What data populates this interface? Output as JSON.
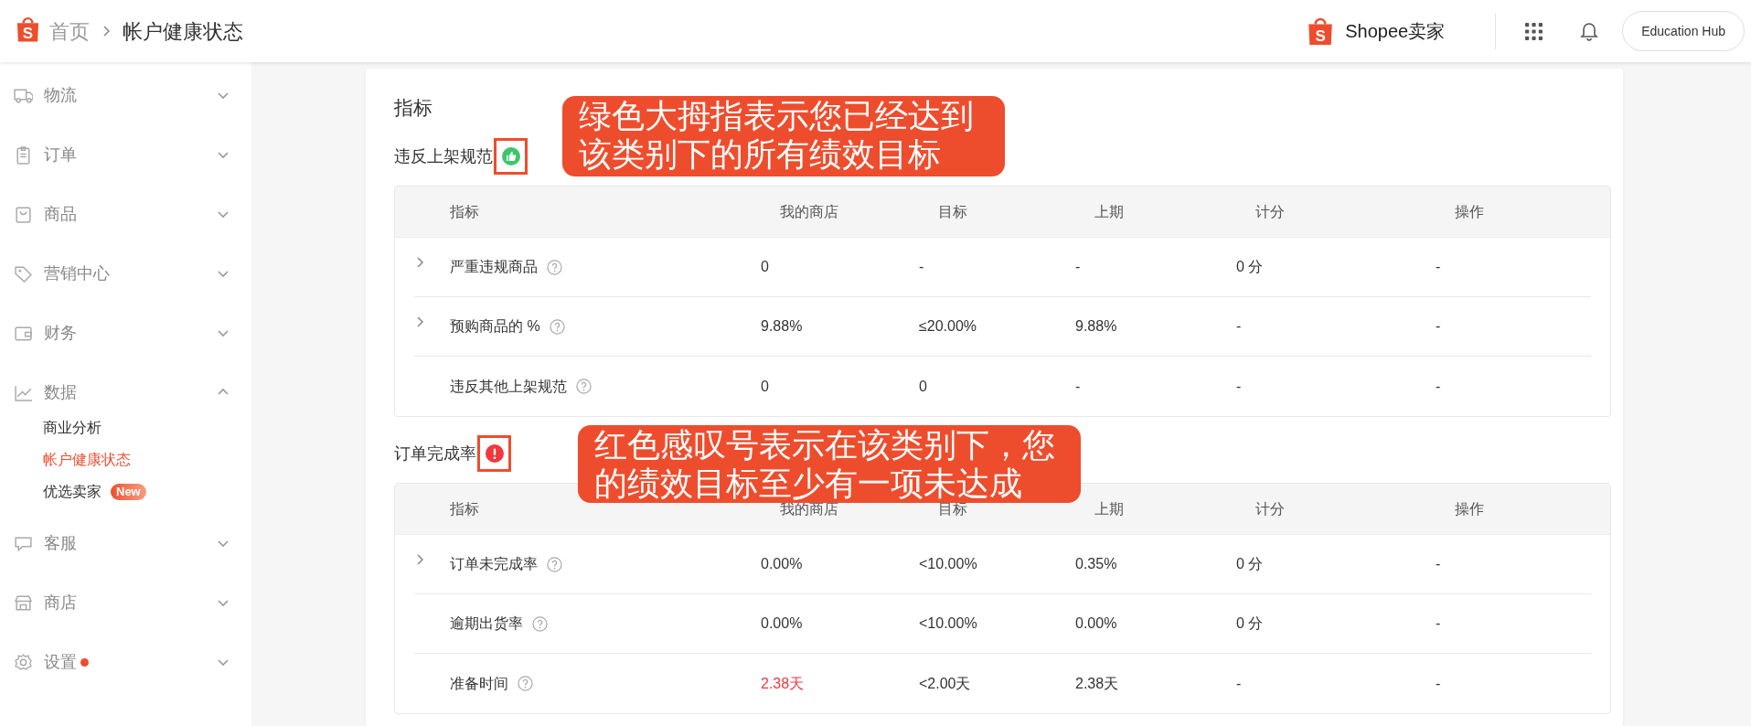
{
  "header": {
    "logo_letter": "S",
    "breadcrumb": [
      {
        "label": "首页"
      },
      {
        "label": "帐户健康状态"
      }
    ],
    "brand": {
      "logo_letter": "S",
      "name": "Shopee卖家"
    },
    "help_button": "Education Hub"
  },
  "sidebar": {
    "items": [
      {
        "label": "物流",
        "expanded": false,
        "notification": false
      },
      {
        "label": "订单",
        "expanded": false,
        "notification": false
      },
      {
        "label": "商品",
        "expanded": false,
        "notification": false
      },
      {
        "label": "营销中心",
        "expanded": false,
        "notification": false
      },
      {
        "label": "财务",
        "expanded": false,
        "notification": false
      },
      {
        "label": "数据",
        "expanded": true,
        "notification": false,
        "children": [
          {
            "label": "商业分析",
            "selected": false
          },
          {
            "label": "帐户健康状态",
            "selected": true
          },
          {
            "label": "优选卖家",
            "selected": false,
            "badge": "New"
          }
        ]
      },
      {
        "label": "客服",
        "expanded": false,
        "notification": false
      },
      {
        "label": "商店",
        "expanded": false,
        "notification": false
      },
      {
        "label": "设置",
        "expanded": false,
        "notification": true
      }
    ]
  },
  "main": {
    "title": "指标",
    "sections": [
      {
        "title": "违反上架规范",
        "goals_met": true,
        "columns": [
          "指标",
          "我的商店",
          "目标",
          "上期",
          "计分",
          "操作"
        ],
        "rows": [
          {
            "expandable": true,
            "off_target": false,
            "cells": [
              "严重违规商品",
              "0",
              "-",
              "-",
              "0 分",
              "-"
            ]
          },
          {
            "expandable": true,
            "off_target": false,
            "cells": [
              "预购商品的 %",
              "9.88%",
              "≤20.00%",
              "9.88%",
              "-",
              "-"
            ]
          },
          {
            "expandable": false,
            "off_target": false,
            "cells": [
              "违反其他上架规范",
              "0",
              "0",
              "-",
              "-",
              "-"
            ]
          }
        ]
      },
      {
        "title": "订单完成率",
        "goals_met": false,
        "columns": [
          "指标",
          "我的商店",
          "目标",
          "上期",
          "计分",
          "操作"
        ],
        "rows": [
          {
            "expandable": true,
            "off_target": false,
            "cells": [
              "订单未完成率",
              "0.00%",
              "<10.00%",
              "0.35%",
              "0 分",
              "-"
            ]
          },
          {
            "expandable": false,
            "off_target": false,
            "cells": [
              "逾期出货率",
              "0.00%",
              "<10.00%",
              "0.00%",
              "0 分",
              "-"
            ]
          },
          {
            "expandable": false,
            "off_target": true,
            "cells": [
              "准备时间",
              "2.38天",
              "<2.00天",
              "2.38天",
              "-",
              "-"
            ]
          }
        ]
      }
    ]
  },
  "callouts": [
    {
      "text": "绿色大拇指表示您已经达到该类别下的所有绩效目标"
    },
    {
      "text": "红色感叹号表示在该类别下，您的绩效目标至少有一项未达成"
    }
  ]
}
